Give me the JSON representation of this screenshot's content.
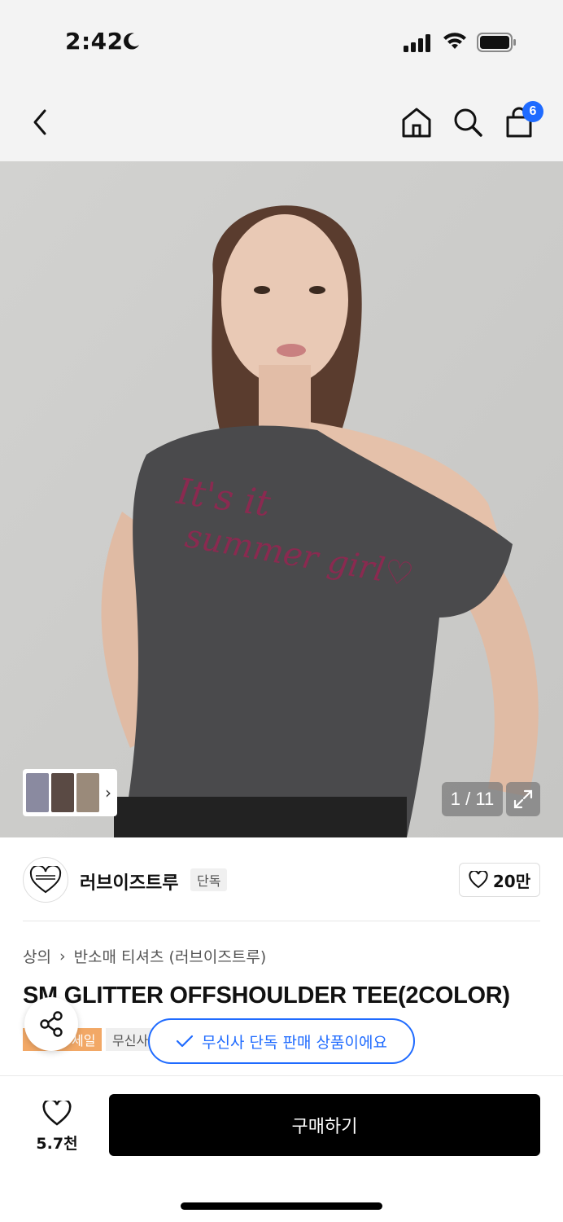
{
  "status_bar": {
    "time": "2:42",
    "icons": [
      "moon-icon",
      "signal-icon",
      "wifi-icon",
      "battery-icon"
    ]
  },
  "header": {
    "cart_count": "6",
    "icons": [
      "back-icon",
      "home-icon",
      "search-icon",
      "cart-icon"
    ]
  },
  "gallery": {
    "counter": "1 / 11"
  },
  "brand": {
    "name": "러브이즈트루",
    "tag": "단독",
    "likes": "20만"
  },
  "breadcrumb": {
    "category": "상의",
    "subcategory": "반소매 티셔츠 (러브이즈트루)"
  },
  "product": {
    "title": "SM GLITTER OFFSHOULDER TEE(2COLOR)",
    "sale_badge": "세일",
    "musinsa_badge": "무신사"
  },
  "exclusive_notice": "무신사 단독 판매 상품이에요",
  "bottom_bar": {
    "wish_count": "5.7천",
    "buy_label": "구매하기"
  },
  "colors": {
    "accent": "#1f6bff",
    "sale": "#f2a866",
    "buy_button": "#000000"
  }
}
